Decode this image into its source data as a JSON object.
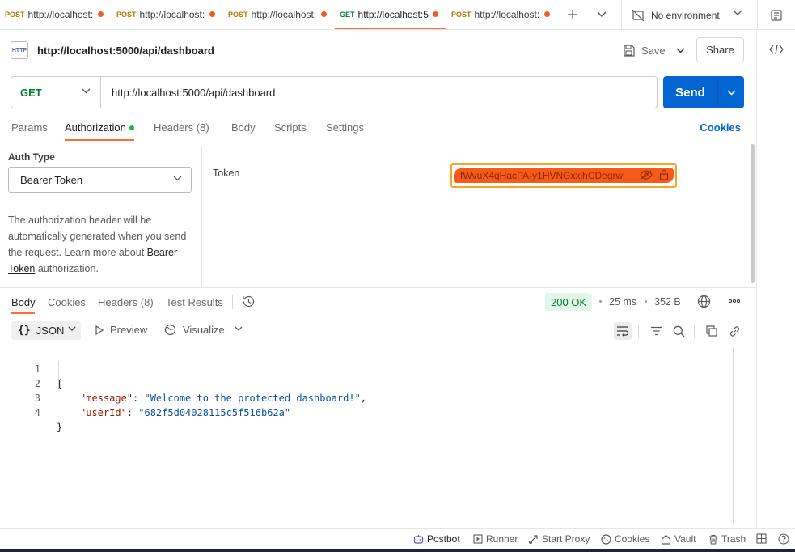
{
  "tabs": [
    {
      "method": "POST",
      "url": "http://localhost:",
      "active": false
    },
    {
      "method": "POST",
      "url": "http://localhost:",
      "active": false
    },
    {
      "method": "POST",
      "url": "http://localhost:",
      "active": false
    },
    {
      "method": "GET",
      "url": "http://localhost:5",
      "active": true
    },
    {
      "method": "POST",
      "url": "http://localhost:",
      "active": false
    }
  ],
  "environment": {
    "label": "No environment"
  },
  "request": {
    "title": "http://localhost:5000/api/dashboard",
    "badge": "HTTP",
    "save_label": "Save",
    "share_label": "Share",
    "method": "GET",
    "url": "http://localhost:5000/api/dashboard",
    "send_label": "Send"
  },
  "request_tabs": {
    "params": "Params",
    "authorization": "Authorization",
    "headers": "Headers",
    "headers_count": "(8)",
    "body": "Body",
    "scripts": "Scripts",
    "settings": "Settings",
    "cookies": "Cookies"
  },
  "auth": {
    "type_label": "Auth Type",
    "type_value": "Bearer Token",
    "desc_part1": "The authorization header will be automatically generated when you send the request. Learn more about ",
    "desc_link": "Bearer Token",
    "desc_part2": " authorization.",
    "token_label": "Token",
    "token_value": "fWvuX4qHacPA-y1HVNGxxjhCDegrw"
  },
  "response_tabs": {
    "body": "Body",
    "cookies": "Cookies",
    "headers": "Headers",
    "headers_count": "(8)",
    "test_results": "Test Results"
  },
  "response_meta": {
    "status": "200 OK",
    "time": "25 ms",
    "size": "352 B"
  },
  "response_toolbar": {
    "format": "JSON",
    "preview": "Preview",
    "visualize": "Visualize"
  },
  "response_body": [
    {
      "num": "1",
      "text": "{"
    },
    {
      "num": "2",
      "key": "\"message\"",
      "value": "\"Welcome to the protected dashboard!\"",
      "trail": ","
    },
    {
      "num": "3",
      "key": "\"userId\"",
      "value": "\"682f5d04028115c5f516b62a\"",
      "trail": ""
    },
    {
      "num": "4",
      "text": "}"
    }
  ],
  "statusbar": {
    "postbot": "Postbot",
    "runner": "Runner",
    "start_proxy": "Start Proxy",
    "cookies": "Cookies",
    "vault": "Vault",
    "trash": "Trash"
  },
  "colors": {
    "accent": "#ff6c37",
    "send": "#0265d2",
    "get": "#007f31",
    "post": "#ad7a03",
    "status_ok": "#007f31"
  }
}
